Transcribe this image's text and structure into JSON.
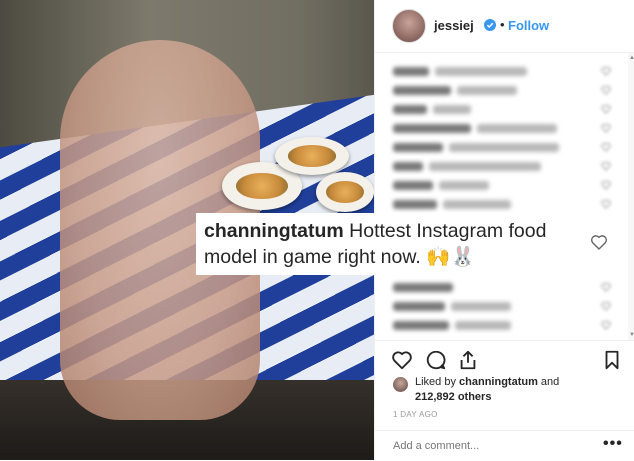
{
  "post": {
    "username": "jessiej",
    "follow_label": "Follow",
    "dot": "•"
  },
  "icons": {
    "verified": "verified-badge-icon",
    "like": "heart-icon",
    "comment": "comment-icon",
    "share": "share-icon",
    "save": "bookmark-icon",
    "more": "more-options-icon"
  },
  "colors": {
    "accent": "#3897f0",
    "text": "#262626",
    "muted": "#999999"
  },
  "highlight_comment": {
    "username": "channingtatum",
    "text": " Hottest Instagram food model in game right now. 🙌🐰"
  },
  "likes": {
    "prefix": "Liked by ",
    "liker": "channingtatum",
    "suffix": " and",
    "count": "212,892 others"
  },
  "timestamp": "1 DAY AGO",
  "add_comment": {
    "placeholder": "Add a comment...",
    "more_label": "•••"
  }
}
